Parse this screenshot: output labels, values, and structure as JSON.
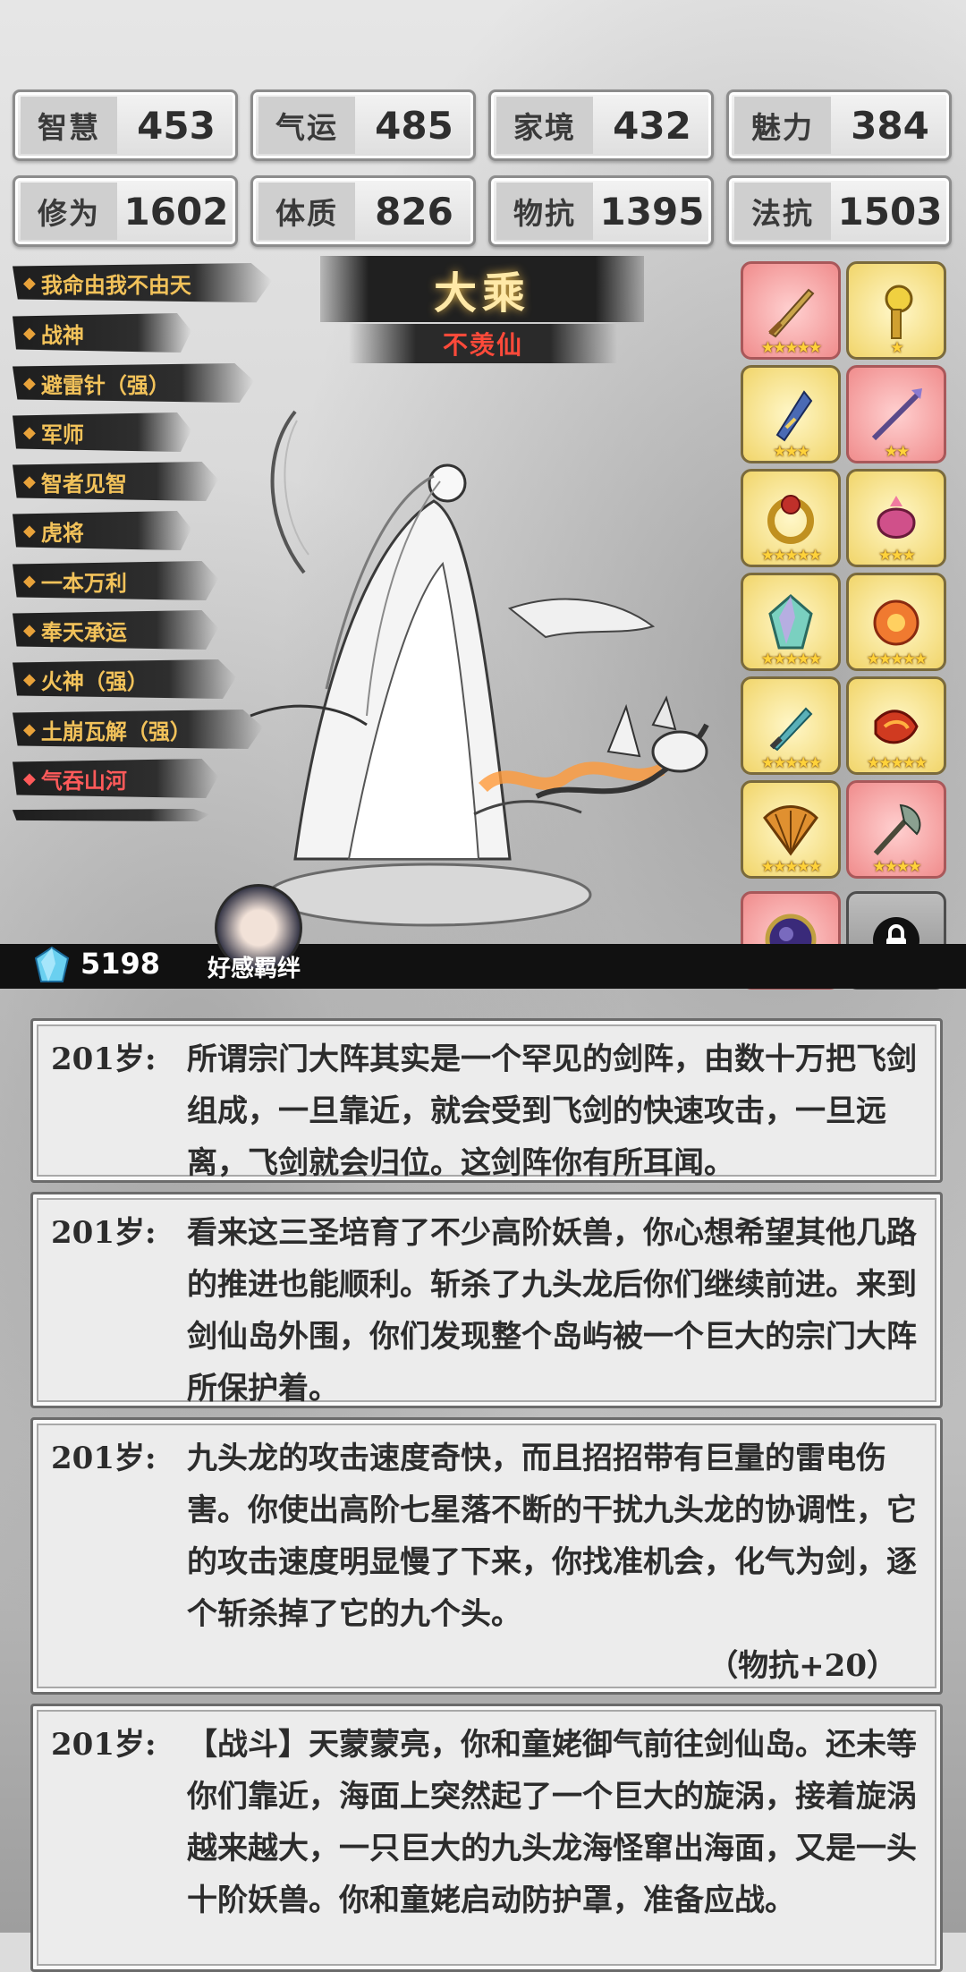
{
  "stats": [
    {
      "label": "智慧",
      "value": "453"
    },
    {
      "label": "气运",
      "value": "485"
    },
    {
      "label": "家境",
      "value": "432"
    },
    {
      "label": "魅力",
      "value": "384"
    },
    {
      "label": "修为",
      "value": "1602"
    },
    {
      "label": "体质",
      "value": "826"
    },
    {
      "label": "物抗",
      "value": "1395"
    },
    {
      "label": "法抗",
      "value": "1503"
    }
  ],
  "skills": [
    {
      "label": "我命由我不由天"
    },
    {
      "label": "战神"
    },
    {
      "label": "避雷针（强）"
    },
    {
      "label": "军师"
    },
    {
      "label": "智者见智"
    },
    {
      "label": "虎将"
    },
    {
      "label": "一本万利"
    },
    {
      "label": "奉天承运"
    },
    {
      "label": "火神（强）"
    },
    {
      "label": "土崩瓦解（强）"
    },
    {
      "label": "气吞山河"
    }
  ],
  "realm": {
    "title": "大乘",
    "subtitle": "不羡仙"
  },
  "equipment": [
    {
      "icon": "sword-icon",
      "stars": "★★★★★",
      "color": "#c9a44a"
    },
    {
      "icon": "scepter-icon",
      "stars": "★",
      "color": "#d9b43a"
    },
    {
      "icon": "blade-icon",
      "stars": "★★★",
      "color": "#4a6ab4"
    },
    {
      "icon": "spear-icon",
      "stars": "★★",
      "color": "#6a5aa4"
    },
    {
      "icon": "ring-icon",
      "stars": "★★★★★",
      "color": "#b0302a"
    },
    {
      "icon": "pouch-icon",
      "stars": "★★★",
      "color": "#c0407a"
    },
    {
      "icon": "crystal-icon",
      "stars": "★★★★★",
      "color": "#4ac0a0"
    },
    {
      "icon": "flame-orb-icon",
      "stars": "★★★★★",
      "color": "#e0602a"
    },
    {
      "icon": "dagger-icon",
      "stars": "★★★★★",
      "color": "#3a9aa0"
    },
    {
      "icon": "fire-scroll-icon",
      "stars": "★★★★★",
      "color": "#c03020"
    },
    {
      "icon": "fan-icon",
      "stars": "★★★★★",
      "color": "#d08020"
    },
    {
      "icon": "axe-icon",
      "stars": "★★★★",
      "color": "#6a8a80"
    },
    {
      "icon": "mirror-icon",
      "stars": "★★★★★",
      "color": "#4a3a8a"
    }
  ],
  "spirit_stones": "5198",
  "favor_label": "好感羁绊",
  "logs": [
    {
      "age": "201岁:",
      "text": "所谓宗门大阵其实是一个罕见的剑阵，由数十万把飞剑组成，一旦靠近，就会受到飞剑的快速攻击，一旦远离，飞剑就会归位。这剑阵你有所耳闻。",
      "gain": ""
    },
    {
      "age": "201岁:",
      "text": "看来这三圣培育了不少高阶妖兽，你心想希望其他几路的推进也能顺利。斩杀了九头龙后你们继续前进。来到剑仙岛外围，你们发现整个岛屿被一个巨大的宗门大阵所保护着。",
      "gain": ""
    },
    {
      "age": "201岁:",
      "text": "九头龙的攻击速度奇快，而且招招带有巨量的雷电伤害。你使出高阶七星落不断的干扰九头龙的协调性，它的攻击速度明显慢了下来，你找准机会，化气为剑，逐个斩杀掉了它的九个头。",
      "gain": "（物抗+20）"
    },
    {
      "age": "201岁:",
      "text": "【战斗】天蒙蒙亮，你和童姥御气前往剑仙岛。还未等你们靠近，海面上突然起了一个巨大的旋涡，接着旋涡越来越大，一只巨大的九头龙海怪窜出海面，又是一头十阶妖兽。你和童姥启动防护罩，准备应战。",
      "gain": ""
    }
  ]
}
